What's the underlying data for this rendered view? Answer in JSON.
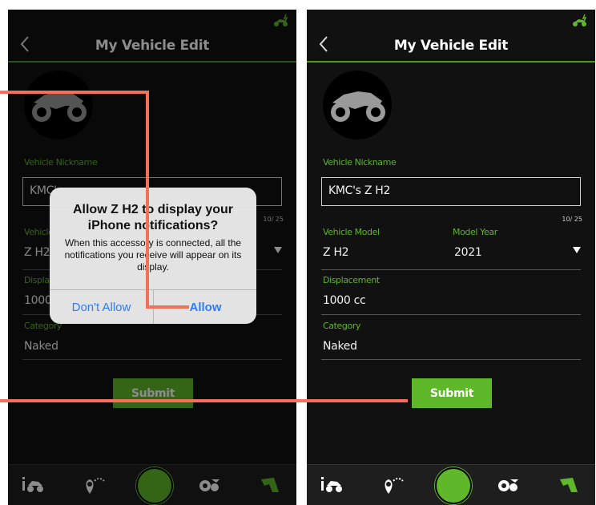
{
  "colors": {
    "accent": "#5fb82a",
    "label": "#61b22a",
    "link": "#2f7df6",
    "annotation": "#f47158",
    "background": "#111111"
  },
  "left_screen": {
    "header": {
      "title": "My Vehicle Edit"
    },
    "fields": {
      "nickname_label": "Vehicle Nickname",
      "nickname_value": "KMC'",
      "counter": "10/ 25",
      "model_label": "Vehicle",
      "model_value": "Z H2",
      "displacement_label": "Displace",
      "displacement_value": "1000",
      "category_label": "Category",
      "category_value": "Naked"
    },
    "submit_label": "Submit",
    "alert": {
      "title": "Allow Z H2 to display your iPhone notifications?",
      "message": "When this accessory is connected, all the notifications you receive will appear on its display.",
      "dont_allow": "Don't Allow",
      "allow": "Allow"
    }
  },
  "right_screen": {
    "header": {
      "title": "My Vehicle Edit"
    },
    "fields": {
      "nickname_label": "Vehicle Nickname",
      "nickname_value": "KMC's Z H2",
      "counter": "10/ 25",
      "model_label": "Vehicle Model",
      "model_value": "Z H2",
      "year_label": "Model Year",
      "year_value": "2021",
      "displacement_label": "Displacement",
      "displacement_value": "1000 cc",
      "category_label": "Category",
      "category_value": "Naked"
    },
    "submit_label": "Submit"
  },
  "icons": [
    "back-chevron-icon",
    "motorcycle-icon",
    "vehicle-info-icon",
    "route-icon",
    "home-icon",
    "settings-icon",
    "brand-logo-icon"
  ]
}
